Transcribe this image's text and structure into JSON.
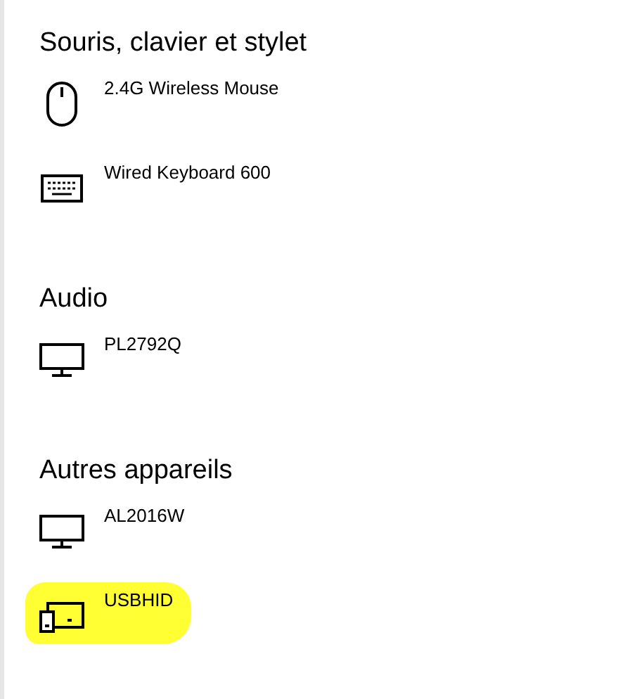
{
  "sections": [
    {
      "title": "Souris, clavier et stylet",
      "devices": [
        {
          "name": "2.4G Wireless Mouse",
          "kind": "mouse",
          "highlighted": false
        },
        {
          "name": "Wired Keyboard 600",
          "kind": "keyboard",
          "highlighted": false
        }
      ]
    },
    {
      "title": "Audio",
      "devices": [
        {
          "name": "PL2792Q",
          "kind": "monitor",
          "highlighted": false
        }
      ]
    },
    {
      "title": "Autres appareils",
      "devices": [
        {
          "name": "AL2016W",
          "kind": "monitor",
          "highlighted": false
        },
        {
          "name": "USBHID",
          "kind": "multi",
          "highlighted": true
        }
      ]
    }
  ]
}
